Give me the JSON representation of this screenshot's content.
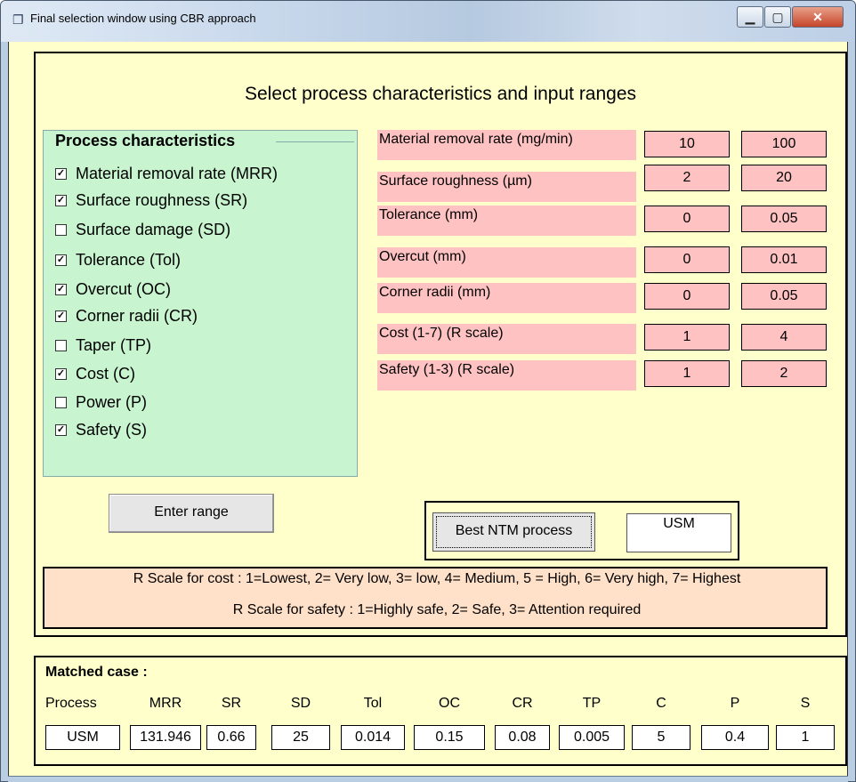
{
  "window": {
    "title": "Final selection window using CBR approach",
    "icon": "window-icon",
    "minimize": "▁",
    "maximize": "▢",
    "close": "✕"
  },
  "heading": "Select process characteristics and input ranges",
  "process_characteristics": {
    "title": "Process characteristics",
    "items": [
      {
        "label": "Material removal rate (MRR)",
        "checked": true
      },
      {
        "label": "Surface roughness (SR)",
        "checked": true
      },
      {
        "label": "Surface damage (SD)",
        "checked": false
      },
      {
        "label": "Tolerance (Tol)",
        "checked": true
      },
      {
        "label": "Overcut (OC)",
        "checked": true
      },
      {
        "label": "Corner radii (CR)",
        "checked": true
      },
      {
        "label": "Taper (TP)",
        "checked": false
      },
      {
        "label": "Cost (C)",
        "checked": true
      },
      {
        "label": "Power (P)",
        "checked": false
      },
      {
        "label": "Safety (S)",
        "checked": true
      }
    ]
  },
  "ranges": [
    {
      "label": "Material removal rate (mg/min)",
      "min": "10",
      "max": "100"
    },
    {
      "label": "Surface roughness (µm)",
      "min": "2",
      "max": "20"
    },
    {
      "label": "Tolerance (mm)",
      "min": "0",
      "max": "0.05"
    },
    {
      "label": "Overcut (mm)",
      "min": "0",
      "max": "0.01"
    },
    {
      "label": "Corner radii (mm)",
      "min": "0",
      "max": "0.05"
    },
    {
      "label": "Cost (1-7) (R scale)",
      "min": "1",
      "max": "4"
    },
    {
      "label": "Safety (1-3) (R scale)",
      "min": "1",
      "max": "2"
    }
  ],
  "buttons": {
    "enter_range": "Enter range",
    "best_process": "Best NTM process"
  },
  "best_result": "USM",
  "scale_notes": {
    "cost": "R Scale for cost : 1=Lowest, 2= Very low, 3= low, 4= Medium, 5 = High, 6= Very high, 7= Highest",
    "safety": "R Scale for safety : 1=Highly safe, 2= Safe, 3= Attention required"
  },
  "matched_case": {
    "title": "Matched case :",
    "headers": [
      "Process",
      "MRR",
      "SR",
      "SD",
      "Tol",
      "OC",
      "CR",
      "TP",
      "C",
      "P",
      "S"
    ],
    "values": [
      "USM",
      "131.946",
      "0.66",
      "25",
      "0.014",
      "0.15",
      "0.08",
      "0.005",
      "5",
      "0.4",
      "1"
    ]
  }
}
